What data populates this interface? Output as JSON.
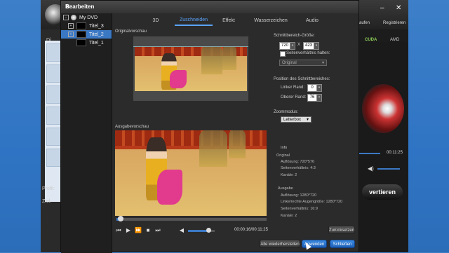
{
  "background_app": {
    "right_menu": {
      "left_item": "aufen",
      "register": "Registrieren"
    },
    "gpu": {
      "cuda": "CUDA",
      "amd": "AMD"
    },
    "left_labels": {
      "profile": "Profil:",
      "target": "Ziel:"
    },
    "time": "00:11:25",
    "convert_label": "vertieren",
    "side_item": "Di"
  },
  "dialog": {
    "title": "Bearbeiten",
    "tree": [
      {
        "label": "My DVD"
      },
      {
        "label": "Titel_3"
      },
      {
        "label": "Titel_2"
      },
      {
        "label": "Titel_1"
      }
    ],
    "tabs": [
      {
        "label": "3D"
      },
      {
        "label": "Zuschneiden"
      },
      {
        "label": "Effekt"
      },
      {
        "label": "Wasserzeichen"
      },
      {
        "label": "Audio"
      }
    ],
    "original_preview_label": "Originalvorschau",
    "output_preview_label": "Ausgabevorschau",
    "crop": {
      "area_size_label": "Schnittbereich-Größe:",
      "width": "720",
      "x_sep": "X",
      "height": "423",
      "keep_ratio_label": "Seitenverhältnis halten:",
      "ratio_value": "Original",
      "position_label": "Position des Schnittbereiches:",
      "left_margin_label": "Linker Rand:",
      "left_margin": "0",
      "top_margin_label": "Oberer Rand:",
      "top_margin": "76",
      "zoom_label": "Zoommodus:",
      "zoom_value": "Letterbox"
    },
    "info": {
      "heading": "Info",
      "original_heading": "Original",
      "orig_resolution": "Auflösung: 720*576",
      "orig_ratio": "Seitenverhältnis: 4:3",
      "orig_channels": "Kanäle: 2",
      "output_heading": "Ausgabe",
      "out_resolution": "Auflösung: 1280*720",
      "out_eye_res": "Linke/rechte Augengröße: 1280*720",
      "out_ratio": "Seitenverhältnis: 16:9",
      "out_channels": "Kanäle: 2"
    },
    "reset_label": "Zurücksetzen",
    "playback": {
      "time": "00:00:16/00:11:25",
      "progress": 0.03,
      "volume": 0.75
    },
    "buttons": {
      "restore_all": "Alle wiederherstellen",
      "apply": "Anwenden",
      "close": "Schließen"
    }
  }
}
